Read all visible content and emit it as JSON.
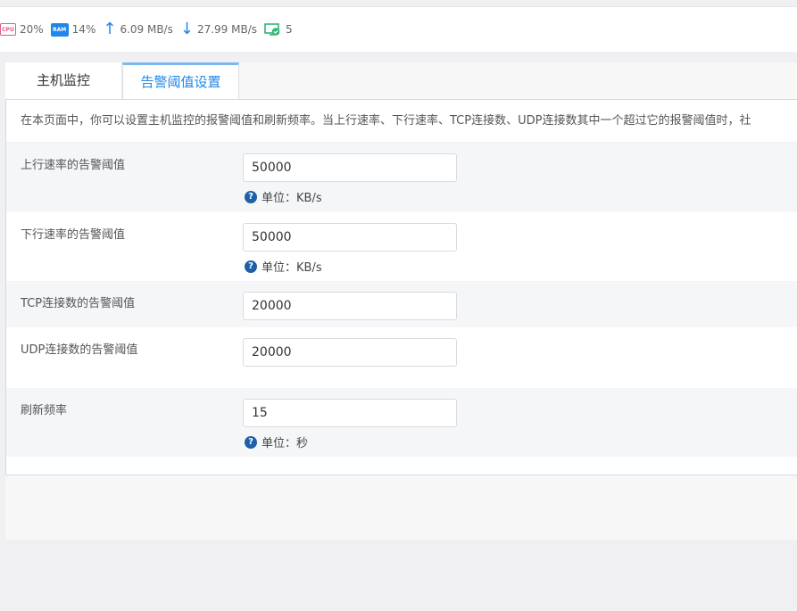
{
  "status": {
    "cpu_label": "CPU",
    "cpu": "20%",
    "ram_label": "RAM",
    "ram": "14%",
    "upload": "6.09 MB/s",
    "download": "27.99 MB/s",
    "connections": "5"
  },
  "tabs": [
    {
      "label": "主机监控"
    },
    {
      "label": "告警阈值设置"
    }
  ],
  "notice": "在本页面中，你可以设置主机监控的报警阈值和刷新频率。当上行速率、下行速率、TCP连接数、UDP连接数其中一个超过它的报警阈值时，社",
  "fields": {
    "upload": {
      "label": "上行速率的告警阈值",
      "value": "50000",
      "unit": "单位：KB/s"
    },
    "download": {
      "label": "下行速率的告警阈值",
      "value": "50000",
      "unit": "单位：KB/s"
    },
    "tcp": {
      "label": "TCP连接数的告警阈值",
      "value": "20000"
    },
    "udp": {
      "label": "UDP连接数的告警阈值",
      "value": "20000"
    },
    "refresh": {
      "label": "刷新频率",
      "value": "15",
      "unit": "单位：秒"
    }
  },
  "colors": {
    "accent": "#1e87e8",
    "help": "#1d5fa8",
    "cpu": "#e05a8b",
    "ok": "#2bb673"
  }
}
